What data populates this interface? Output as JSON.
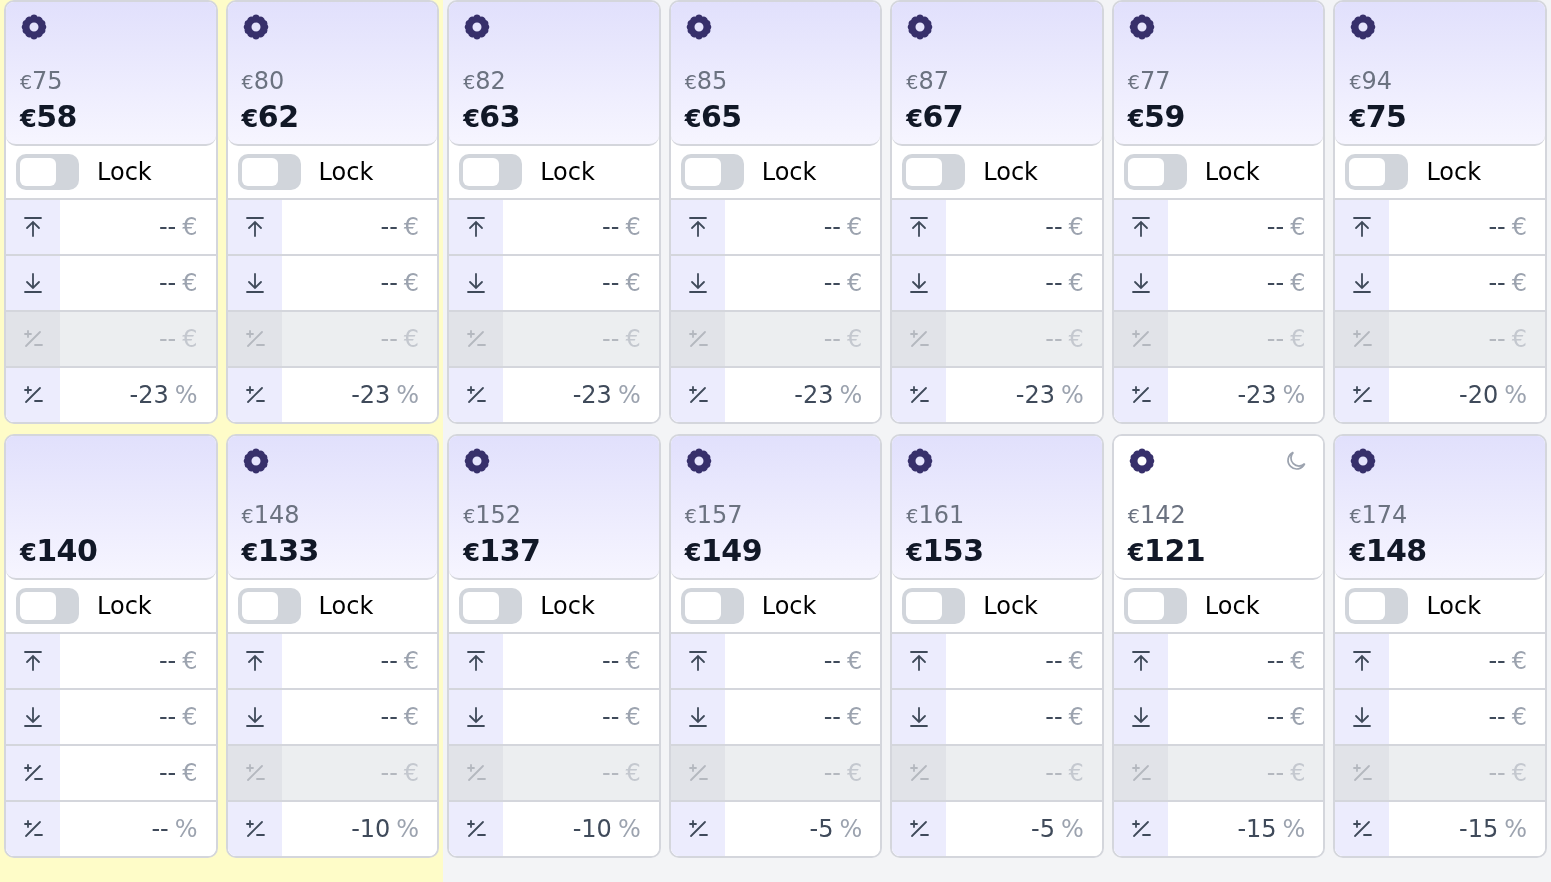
{
  "columns": [
    {
      "highlighted": true,
      "cards": [
        {
          "gear": true,
          "night": false,
          "old_price": {
            "currency": "€",
            "amount": "75"
          },
          "price": {
            "currency": "€",
            "amount": "58"
          },
          "lock": {
            "label": "Lock",
            "on": false
          },
          "rows": [
            {
              "kind": "max",
              "value": "--",
              "unit": "€",
              "disabled": false
            },
            {
              "kind": "min",
              "value": "--",
              "unit": "€",
              "disabled": false
            },
            {
              "kind": "change",
              "value": "--",
              "unit": "€",
              "disabled": true
            },
            {
              "kind": "change",
              "value": "-23",
              "unit": "%",
              "disabled": false
            }
          ]
        },
        {
          "gear": false,
          "night": false,
          "price": {
            "currency": "€",
            "amount": "140"
          },
          "lock": {
            "label": "Lock",
            "on": false
          },
          "rows": [
            {
              "kind": "max",
              "value": "--",
              "unit": "€",
              "disabled": false
            },
            {
              "kind": "min",
              "value": "--",
              "unit": "€",
              "disabled": false
            },
            {
              "kind": "change",
              "value": "--",
              "unit": "€",
              "disabled": false
            },
            {
              "kind": "change",
              "value": "--",
              "unit": "%",
              "disabled": false
            }
          ]
        }
      ]
    },
    {
      "highlighted": true,
      "cards": [
        {
          "gear": true,
          "night": false,
          "old_price": {
            "currency": "€",
            "amount": "80"
          },
          "price": {
            "currency": "€",
            "amount": "62"
          },
          "lock": {
            "label": "Lock",
            "on": false
          },
          "rows": [
            {
              "kind": "max",
              "value": "--",
              "unit": "€",
              "disabled": false
            },
            {
              "kind": "min",
              "value": "--",
              "unit": "€",
              "disabled": false
            },
            {
              "kind": "change",
              "value": "--",
              "unit": "€",
              "disabled": true
            },
            {
              "kind": "change",
              "value": "-23",
              "unit": "%",
              "disabled": false
            }
          ]
        },
        {
          "gear": true,
          "night": false,
          "old_price": {
            "currency": "€",
            "amount": "148"
          },
          "price": {
            "currency": "€",
            "amount": "133"
          },
          "lock": {
            "label": "Lock",
            "on": false
          },
          "rows": [
            {
              "kind": "max",
              "value": "--",
              "unit": "€",
              "disabled": false
            },
            {
              "kind": "min",
              "value": "--",
              "unit": "€",
              "disabled": false
            },
            {
              "kind": "change",
              "value": "--",
              "unit": "€",
              "disabled": true
            },
            {
              "kind": "change",
              "value": "-10",
              "unit": "%",
              "disabled": false
            }
          ]
        }
      ]
    },
    {
      "highlighted": false,
      "cards": [
        {
          "gear": true,
          "night": false,
          "old_price": {
            "currency": "€",
            "amount": "82"
          },
          "price": {
            "currency": "€",
            "amount": "63"
          },
          "lock": {
            "label": "Lock",
            "on": false
          },
          "rows": [
            {
              "kind": "max",
              "value": "--",
              "unit": "€",
              "disabled": false
            },
            {
              "kind": "min",
              "value": "--",
              "unit": "€",
              "disabled": false
            },
            {
              "kind": "change",
              "value": "--",
              "unit": "€",
              "disabled": true
            },
            {
              "kind": "change",
              "value": "-23",
              "unit": "%",
              "disabled": false
            }
          ]
        },
        {
          "gear": true,
          "night": false,
          "old_price": {
            "currency": "€",
            "amount": "152"
          },
          "price": {
            "currency": "€",
            "amount": "137"
          },
          "lock": {
            "label": "Lock",
            "on": false
          },
          "rows": [
            {
              "kind": "max",
              "value": "--",
              "unit": "€",
              "disabled": false
            },
            {
              "kind": "min",
              "value": "--",
              "unit": "€",
              "disabled": false
            },
            {
              "kind": "change",
              "value": "--",
              "unit": "€",
              "disabled": true
            },
            {
              "kind": "change",
              "value": "-10",
              "unit": "%",
              "disabled": false
            }
          ]
        }
      ]
    },
    {
      "highlighted": false,
      "cards": [
        {
          "gear": true,
          "night": false,
          "old_price": {
            "currency": "€",
            "amount": "85"
          },
          "price": {
            "currency": "€",
            "amount": "65"
          },
          "lock": {
            "label": "Lock",
            "on": false
          },
          "rows": [
            {
              "kind": "max",
              "value": "--",
              "unit": "€",
              "disabled": false
            },
            {
              "kind": "min",
              "value": "--",
              "unit": "€",
              "disabled": false
            },
            {
              "kind": "change",
              "value": "--",
              "unit": "€",
              "disabled": true
            },
            {
              "kind": "change",
              "value": "-23",
              "unit": "%",
              "disabled": false
            }
          ]
        },
        {
          "gear": true,
          "night": false,
          "old_price": {
            "currency": "€",
            "amount": "157"
          },
          "price": {
            "currency": "€",
            "amount": "149"
          },
          "lock": {
            "label": "Lock",
            "on": false
          },
          "rows": [
            {
              "kind": "max",
              "value": "--",
              "unit": "€",
              "disabled": false
            },
            {
              "kind": "min",
              "value": "--",
              "unit": "€",
              "disabled": false
            },
            {
              "kind": "change",
              "value": "--",
              "unit": "€",
              "disabled": true
            },
            {
              "kind": "change",
              "value": "-5",
              "unit": "%",
              "disabled": false
            }
          ]
        }
      ]
    },
    {
      "highlighted": false,
      "cards": [
        {
          "gear": true,
          "night": false,
          "old_price": {
            "currency": "€",
            "amount": "87"
          },
          "price": {
            "currency": "€",
            "amount": "67"
          },
          "lock": {
            "label": "Lock",
            "on": false
          },
          "rows": [
            {
              "kind": "max",
              "value": "--",
              "unit": "€",
              "disabled": false
            },
            {
              "kind": "min",
              "value": "--",
              "unit": "€",
              "disabled": false
            },
            {
              "kind": "change",
              "value": "--",
              "unit": "€",
              "disabled": true
            },
            {
              "kind": "change",
              "value": "-23",
              "unit": "%",
              "disabled": false
            }
          ]
        },
        {
          "gear": true,
          "night": false,
          "old_price": {
            "currency": "€",
            "amount": "161"
          },
          "price": {
            "currency": "€",
            "amount": "153"
          },
          "lock": {
            "label": "Lock",
            "on": false
          },
          "rows": [
            {
              "kind": "max",
              "value": "--",
              "unit": "€",
              "disabled": false
            },
            {
              "kind": "min",
              "value": "--",
              "unit": "€",
              "disabled": false
            },
            {
              "kind": "change",
              "value": "--",
              "unit": "€",
              "disabled": true
            },
            {
              "kind": "change",
              "value": "-5",
              "unit": "%",
              "disabled": false
            }
          ]
        }
      ]
    },
    {
      "highlighted": false,
      "cards": [
        {
          "gear": true,
          "night": false,
          "old_price": {
            "currency": "€",
            "amount": "77"
          },
          "price": {
            "currency": "€",
            "amount": "59"
          },
          "lock": {
            "label": "Lock",
            "on": false
          },
          "rows": [
            {
              "kind": "max",
              "value": "--",
              "unit": "€",
              "disabled": false
            },
            {
              "kind": "min",
              "value": "--",
              "unit": "€",
              "disabled": false
            },
            {
              "kind": "change",
              "value": "--",
              "unit": "€",
              "disabled": true
            },
            {
              "kind": "change",
              "value": "-23",
              "unit": "%",
              "disabled": false
            }
          ]
        },
        {
          "gear": true,
          "night": true,
          "old_price": {
            "currency": "€",
            "amount": "142"
          },
          "price": {
            "currency": "€",
            "amount": "121"
          },
          "lock": {
            "label": "Lock",
            "on": false
          },
          "rows": [
            {
              "kind": "max",
              "value": "--",
              "unit": "€",
              "disabled": false
            },
            {
              "kind": "min",
              "value": "--",
              "unit": "€",
              "disabled": false
            },
            {
              "kind": "change",
              "value": "--",
              "unit": "€",
              "disabled": true
            },
            {
              "kind": "change",
              "value": "-15",
              "unit": "%",
              "disabled": false
            }
          ]
        }
      ]
    },
    {
      "highlighted": false,
      "cards": [
        {
          "gear": true,
          "night": false,
          "old_price": {
            "currency": "€",
            "amount": "94"
          },
          "price": {
            "currency": "€",
            "amount": "75"
          },
          "lock": {
            "label": "Lock",
            "on": false
          },
          "rows": [
            {
              "kind": "max",
              "value": "--",
              "unit": "€",
              "disabled": false
            },
            {
              "kind": "min",
              "value": "--",
              "unit": "€",
              "disabled": false
            },
            {
              "kind": "change",
              "value": "--",
              "unit": "€",
              "disabled": true
            },
            {
              "kind": "change",
              "value": "-20",
              "unit": "%",
              "disabled": false
            }
          ]
        },
        {
          "gear": true,
          "night": false,
          "old_price": {
            "currency": "€",
            "amount": "174"
          },
          "price": {
            "currency": "€",
            "amount": "148"
          },
          "lock": {
            "label": "Lock",
            "on": false
          },
          "rows": [
            {
              "kind": "max",
              "value": "--",
              "unit": "€",
              "disabled": false
            },
            {
              "kind": "min",
              "value": "--",
              "unit": "€",
              "disabled": false
            },
            {
              "kind": "change",
              "value": "--",
              "unit": "€",
              "disabled": true
            },
            {
              "kind": "change",
              "value": "-15",
              "unit": "%",
              "disabled": false
            }
          ]
        }
      ]
    }
  ]
}
